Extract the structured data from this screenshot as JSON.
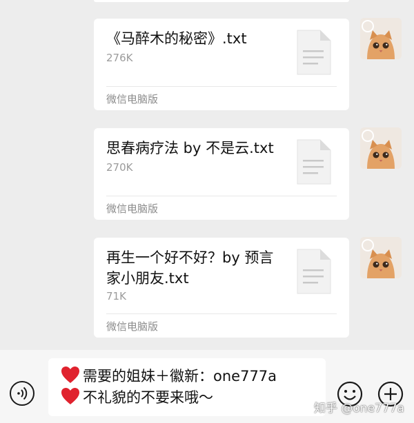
{
  "messages": [
    {
      "file_name": "《马醉木的秘密》.txt",
      "file_size": "276K",
      "source": "微信电脑版"
    },
    {
      "file_name": "思春病疗法 by 不是云.txt",
      "file_size": "270K",
      "source": "微信电脑版"
    },
    {
      "file_name": "再生一个好不好？by 预言家小朋友.txt",
      "file_size": "71K",
      "source": "微信电脑版"
    }
  ],
  "input": {
    "line1": "需要的姐妹＋徽新：one777a",
    "line2": "不礼貌的不要来哦～"
  },
  "watermark": "知乎 @one777a",
  "icons": {
    "file": "document-icon",
    "voice": "voice-icon",
    "emoji": "emoji-icon",
    "plus": "plus-icon",
    "heart": "red-heart-emoji"
  },
  "colors": {
    "chat_background": "#ededed",
    "bubble": "#ffffff",
    "heart": "#e0222e"
  }
}
